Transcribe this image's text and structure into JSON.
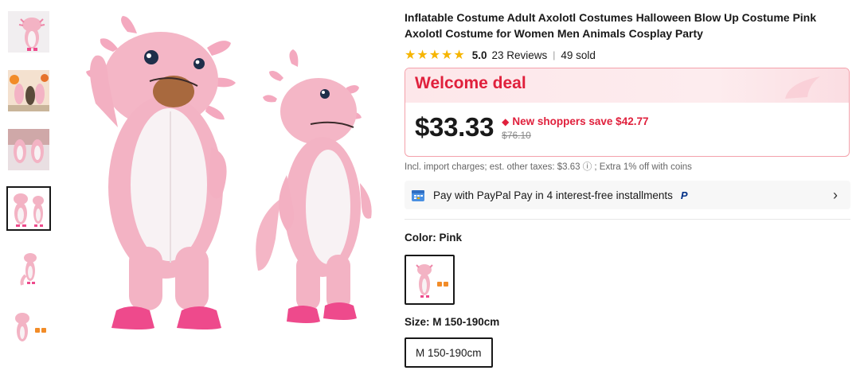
{
  "product": {
    "title": "Inflatable Costume Adult Axolotl Costumes Halloween Blow Up Costume Pink Axolotl Costume for Women Men Animals Cosplay Party",
    "rating": {
      "stars": "★★★★★",
      "score": "5.0",
      "reviews": "23 Reviews",
      "separator": "|",
      "sold": "49 sold"
    },
    "deal": {
      "title": "Welcome deal",
      "price": "$33.33",
      "savings": "New shoppers save $42.77",
      "original_price": "$76.10"
    },
    "tax_note": "Incl. import charges; est. other taxes: $3.63 ⓘ ; Extra 1% off with coins",
    "paypal": {
      "text": "Pay with PayPal Pay in 4 interest-free installments",
      "logo": "P"
    },
    "color": {
      "label": "Color: Pink",
      "selected": "Pink"
    },
    "size": {
      "label": "Size: M 150-190cm",
      "options": [
        "M 150-190cm"
      ]
    }
  },
  "thumbnails": {
    "count": 6,
    "active_index": 3
  },
  "colors": {
    "accent": "#e0203c",
    "deal_border": "#f4a1ab",
    "deal_bg": "#fde7ea",
    "star": "#f6b500",
    "costume_pink": "#f3b3c4",
    "costume_belly": "#f7f3f4",
    "costume_feet": "#ee4a8c"
  },
  "icons": [
    "chevron-right-icon",
    "calendar-icon",
    "paypal-icon",
    "tag-icon",
    "info-icon",
    "star-icon"
  ]
}
